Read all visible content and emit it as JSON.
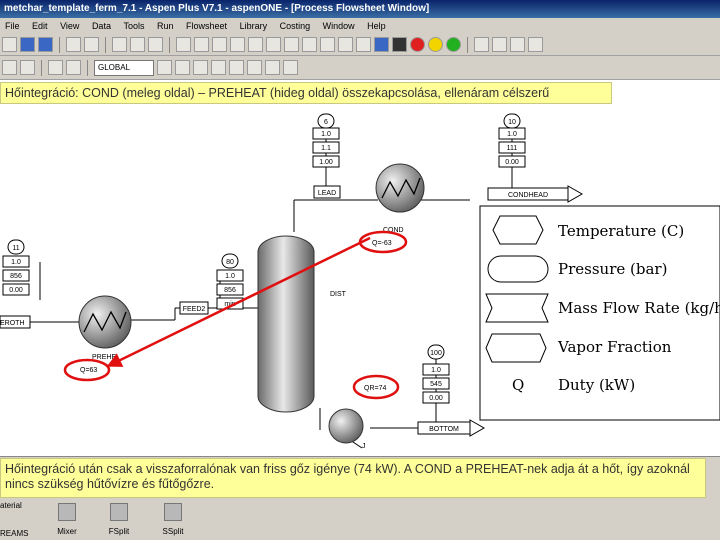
{
  "window": {
    "title": "metchar_template_ferm_7.1 - Aspen Plus V7.1 - aspenONE - [Process Flowsheet Window]"
  },
  "menu": [
    "File",
    "Edit",
    "View",
    "Data",
    "Tools",
    "Run",
    "Flowsheet",
    "Library",
    "Costing",
    "Window",
    "Help"
  ],
  "toolbar": {
    "combo_value": "GLOBAL"
  },
  "callouts": {
    "top": "Hőintegráció: COND (meleg oldal) – PREHEAT (hideg oldal) összekapcsolása, ellenáram célszerű",
    "bottom": "Hőintegráció után csak a visszaforralónak van friss gőz igénye (74 kW). A COND a PREHEAT-nek adja át a hőt, így azoknál nincs szükség hűtővízre és fűtőgőzre."
  },
  "flowsheet": {
    "stream_tags": {
      "cond_top": {
        "id": "6",
        "temp": "1.0",
        "pres": "1.1",
        "flow": "1.00"
      },
      "condhead_top": {
        "id": "10",
        "temp": "1.0",
        "pres": "111",
        "flow": "0.00"
      },
      "feed_left": {
        "id": "11",
        "temp": "1.0",
        "pres": "856",
        "flow": "0.00"
      },
      "feed_mid": {
        "id": "80",
        "temp": "1.0",
        "pres": "856",
        "flow": "min"
      },
      "bottom_tag": {
        "id": "100",
        "temp": "1.0",
        "pres": "545",
        "flow": "0.00"
      }
    },
    "labels": {
      "lead": "LEAD",
      "condhead": "CONDHEAD",
      "cond": "COND",
      "cond_q": "Q=-63",
      "feed2": "FEED2",
      "dist": "DIST",
      "erot": "EROTH",
      "preheat": "PREHE",
      "preheat_q": "Q=63",
      "reb_q": "QR=74",
      "bottom": "BOTTOM",
      "j": "J"
    }
  },
  "legend": {
    "items": [
      "Temperature (C)",
      "Pressure (bar)",
      "Mass Flow Rate (kg/hr)",
      "Vapor Fraction",
      "Duty (kW)"
    ],
    "duty_symbol": "Q"
  },
  "palette": {
    "items": [
      "Mixer",
      "FSplit",
      "SSplit"
    ],
    "left_labels": [
      "aterial",
      "REAMS"
    ]
  }
}
